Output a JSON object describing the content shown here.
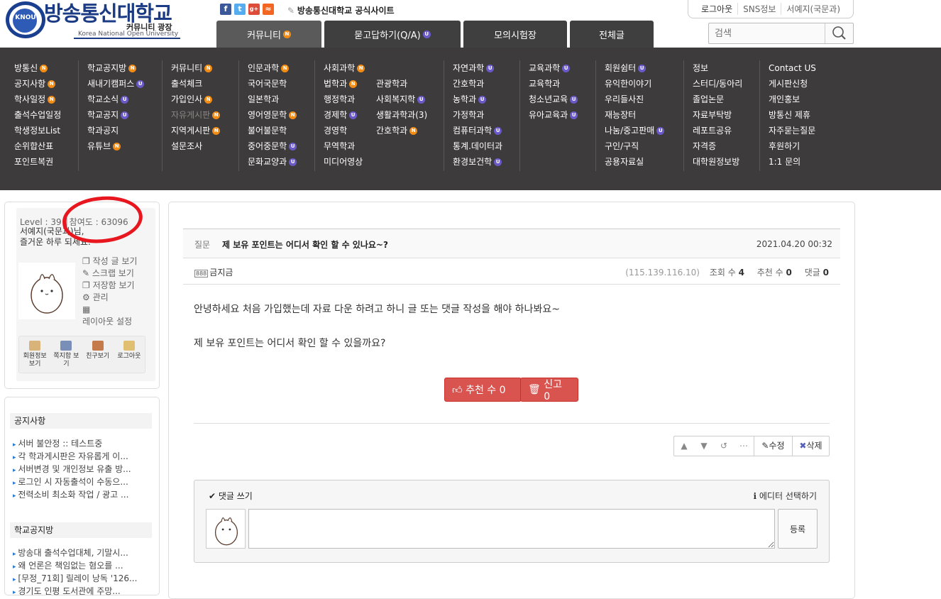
{
  "header": {
    "logo_main": "방송통신대학교",
    "logo_sub": "커뮤니티 광장",
    "logo_en": "Korea National Open University",
    "logo_badge": "KNOU",
    "official_site": "방송통신대학교 공식사이트",
    "tabs": [
      {
        "label": "커뮤니티",
        "badge": "N"
      },
      {
        "label": "묻고답하기(Q/A)",
        "badge": "U"
      },
      {
        "label": "모의시험장",
        "badge": ""
      },
      {
        "label": "전체글",
        "badge": ""
      }
    ],
    "account_links": [
      "로그아웃",
      "SNS정보",
      "서예지(국문과)"
    ],
    "search_placeholder": "검색"
  },
  "mega_menu": [
    [
      "방통신|N",
      "공지사항|N",
      "학사일정|N",
      "출석수업일정",
      "학생정보List",
      "순위합산표",
      "포인트복권"
    ],
    [
      "학교공지방|N",
      "새내기캠퍼스|U",
      "학교소식|U",
      "학교공지|U",
      "학과공지",
      "유튜브|N"
    ],
    [
      "커뮤니티|N",
      "출석체크",
      "가입인사|N",
      "자유게시판|N|dim",
      "지역게시판|N",
      "설문조사"
    ],
    [
      "인문과학|N",
      "국어국문학",
      "일본학과",
      "영어영문학|N",
      "불어불문학",
      "중어중문학|U",
      "문화교양과|U"
    ],
    [
      "사회과학|N",
      "법학과|N",
      "행정학과",
      "경제학|U",
      "경영학",
      "무역학과",
      "미디어영상"
    ],
    [
      "",
      "관광학과",
      "사회복지학|U",
      "생활과학과(3)",
      "간호학과|N"
    ],
    [
      "자연과학|U",
      "간호학과",
      "농학과|U",
      "가정학과",
      "컴퓨터과학|U",
      "통계.데이터과",
      "환경보건학|U"
    ],
    [
      "교육과학|U",
      "교육학과",
      "청소년교육|U",
      "유아교육과|U"
    ],
    [
      "회원쉼터|U",
      "유익한이야기",
      "우리들사진",
      "재능장터",
      "나눔/중고판매|U",
      "구인/구직",
      "공용자료실"
    ],
    [
      "정보",
      "스터디/동아리",
      "졸업논문",
      "자료부탁방",
      "레포트공유",
      "자격증",
      "대학원정보방"
    ],
    [
      "Contact US",
      "게시판신청",
      "개인홍보",
      "방통신 제휴",
      "자주묻는질문",
      "후원하기",
      "1:1 문의"
    ]
  ],
  "profile": {
    "level_text": "Level : 39 │참여도 : 63096",
    "nickname": "서예지(국문과)님,",
    "greeting": "즐거운 하루 되세요.",
    "links": [
      "작성 글 보기",
      "스크랩 보기",
      "저장함 보기",
      "관리",
      "",
      "레이아웃 설정"
    ],
    "quick": [
      "회원정보 보기",
      "쪽지함 보기",
      "친구보기",
      "로그아웃"
    ]
  },
  "sidebar": {
    "notice_title": "공지사항",
    "notices": [
      "서버 불안정 :: 테스트중",
      "각 학과게시판은 자유롭게 이...",
      "서버변경 및 개인정보 유출 방...",
      "로그인 시 자동출석이 수동으...",
      "전력소비 최소화 작업 / 광고 ..."
    ],
    "school_title": "학교공지방",
    "school": [
      "방송대 출석수업대체, 기말시...",
      "왜 언론은 책임없는 혐오를 ...",
      "[무정_71회] 릴레이 낭독 '126...",
      "경기도 인평 도서관에 주망..."
    ]
  },
  "post": {
    "label": "질문",
    "title": "제 보유 포인트는 어디서 확인 할 수 있나요~?",
    "date": "2021.04.20 00:32",
    "author_icon": "888",
    "author": "금지금",
    "ip": "(115.139.116.10)",
    "views_label": "조회 수",
    "views": "4",
    "likes_label": "추천 수",
    "likes": "0",
    "comments_label": "댓글",
    "comments": "0",
    "body_line1": "안녕하세요 처음 가입했는데 자료 다운 하려고 하니 글 또는 댓글 작성을 해야 하나봐요~",
    "body_line2": "제 보유 포인트는 어디서 확인 할 수 있을까요?",
    "vote_label": "추천 수 0",
    "report_label": "신고 0",
    "edit_label": "수정",
    "delete_label": "삭제"
  },
  "comment": {
    "heading": "댓글 쓰기",
    "editor_label": "에디터 선택하기",
    "submit_label": "등록"
  },
  "colors": {
    "accent_red": "#d9534f",
    "menu_bg": "#3d3b3b",
    "badge_n": "#f28c14",
    "badge_u": "#6a5ac9",
    "annotation": "#e8161e"
  }
}
